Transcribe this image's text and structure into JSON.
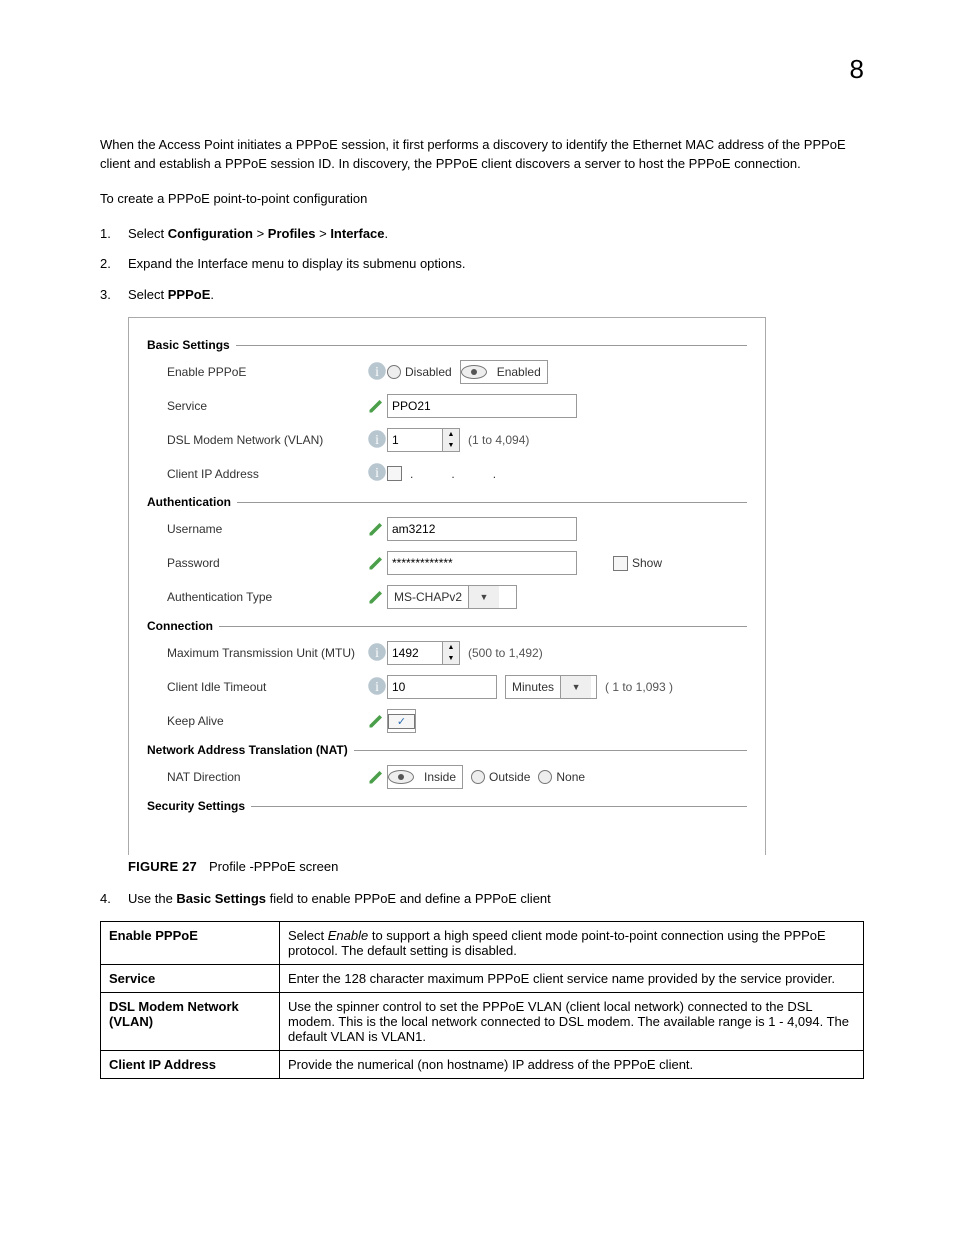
{
  "pageNumber": "8",
  "intro": "When the Access Point initiates a PPPoE session, it first performs a discovery to identify the Ethernet MAC address of the PPPoE client and establish a PPPoE session ID. In discovery, the PPPoE client discovers a server to host the PPPoE connection.",
  "lead": "To create a PPPoE point-to-point configuration",
  "steps": {
    "s1a": "Select ",
    "s1b": "Configuration",
    "s1c": " > ",
    "s1d": "Profiles",
    "s1e": " > ",
    "s1f": "Interface",
    "s1g": ".",
    "s2": "Expand the Interface menu to display its submenu options.",
    "s3a": "Select ",
    "s3b": "PPPoE",
    "s3c": ".",
    "s4a": "Use the ",
    "s4b": "Basic Settings",
    "s4c": " field to enable PPPoE and define a PPPoE client"
  },
  "figure": {
    "label": "FIGURE 27",
    "caption": "Profile -PPPoE screen"
  },
  "form": {
    "basic": {
      "title": "Basic Settings",
      "enable": {
        "label": "Enable PPPoE",
        "optDisabled": "Disabled",
        "optEnabled": "Enabled"
      },
      "service": {
        "label": "Service",
        "value": "PPO21"
      },
      "vlan": {
        "label": "DSL Modem Network (VLAN)",
        "value": "1",
        "hint": "(1 to 4,094)"
      },
      "clientip": {
        "label": "Client IP Address",
        "a": "",
        "b": ".",
        "c": ".",
        "d": "."
      }
    },
    "auth": {
      "title": "Authentication",
      "user": {
        "label": "Username",
        "value": "am3212"
      },
      "pass": {
        "label": "Password",
        "value": "*************",
        "show": "Show"
      },
      "type": {
        "label": "Authentication Type",
        "value": "MS-CHAPv2"
      }
    },
    "conn": {
      "title": "Connection",
      "mtu": {
        "label": "Maximum Transmission Unit (MTU)",
        "value": "1492",
        "hint": "(500 to 1,492)"
      },
      "idle": {
        "label": "Client Idle Timeout",
        "value": "10",
        "unit": "Minutes",
        "hint": "( 1 to 1,093 )"
      },
      "keep": {
        "label": "Keep Alive"
      }
    },
    "nat": {
      "title": "Network Address Translation (NAT)",
      "dir": {
        "label": "NAT Direction",
        "optInside": "Inside",
        "optOutside": "Outside",
        "optNone": "None"
      }
    },
    "security": {
      "title": "Security Settings"
    }
  },
  "table": [
    {
      "k": "Enable PPPoE",
      "v1": "Select ",
      "vi": "Enable",
      "v2": " to support a high speed client mode point-to-point connection using the PPPoE protocol. The default setting is disabled."
    },
    {
      "k": "Service",
      "v": "Enter the 128 character maximum PPPoE client service name provided by the service provider."
    },
    {
      "k": "DSL Modem Network (VLAN)",
      "v": "Use the spinner control to set the PPPoE VLAN (client local network) connected to the DSL modem. This is the local network connected to DSL modem. The available range is 1 - 4,094. The default VLAN is VLAN1."
    },
    {
      "k": "Client IP Address",
      "v": "Provide the numerical (non hostname) IP address of the PPPoE client."
    }
  ]
}
